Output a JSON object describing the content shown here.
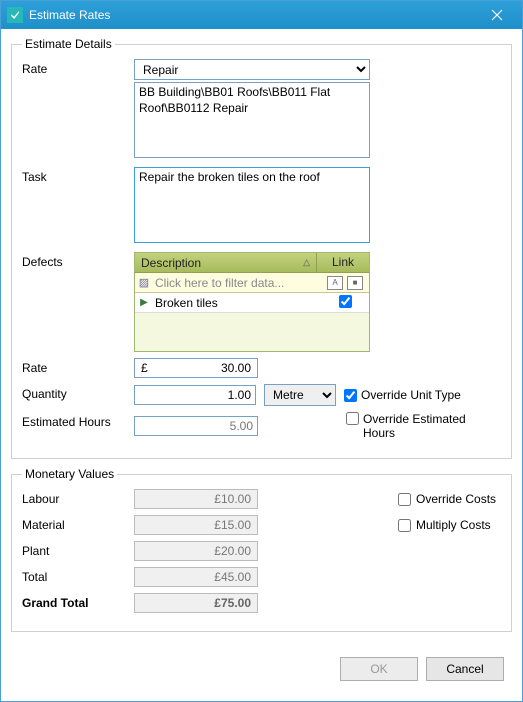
{
  "window": {
    "title": "Estimate Rates"
  },
  "details": {
    "legend": "Estimate Details",
    "rate_label": "Rate",
    "rate_selected": "Repair",
    "rate_path": "BB Building\\BB01 Roofs\\BB011 Flat Roof\\BB0112 Repair",
    "task_label": "Task",
    "task_text": "Repair the broken tiles on the roof",
    "defects_label": "Defects",
    "defects_cols": {
      "desc": "Description",
      "link": "Link"
    },
    "defects_filter": "Click here to filter data...",
    "defects_rows": [
      {
        "desc": "Broken tiles",
        "link": true
      }
    ],
    "rate2_label": "Rate",
    "rate2_prefix": "£",
    "rate2_value": "30.00",
    "quantity_label": "Quantity",
    "quantity_value": "1.00",
    "unit_selected": "Metre",
    "override_unit_label": "Override Unit Type",
    "override_unit_checked": true,
    "est_hours_label": "Estimated Hours",
    "est_hours_value": "5.00",
    "override_hours_label": "Override Estimated Hours",
    "override_hours_checked": false
  },
  "monetary": {
    "legend": "Monetary Values",
    "labour_label": "Labour",
    "labour_value": "£10.00",
    "material_label": "Material",
    "material_value": "£15.00",
    "plant_label": "Plant",
    "plant_value": "£20.00",
    "total_label": "Total",
    "total_value": "£45.00",
    "grand_label": "Grand Total",
    "grand_value": "£75.00",
    "override_costs_label": "Override Costs",
    "override_costs_checked": false,
    "multiply_costs_label": "Multiply Costs",
    "multiply_costs_checked": false
  },
  "buttons": {
    "ok": "OK",
    "cancel": "Cancel"
  }
}
